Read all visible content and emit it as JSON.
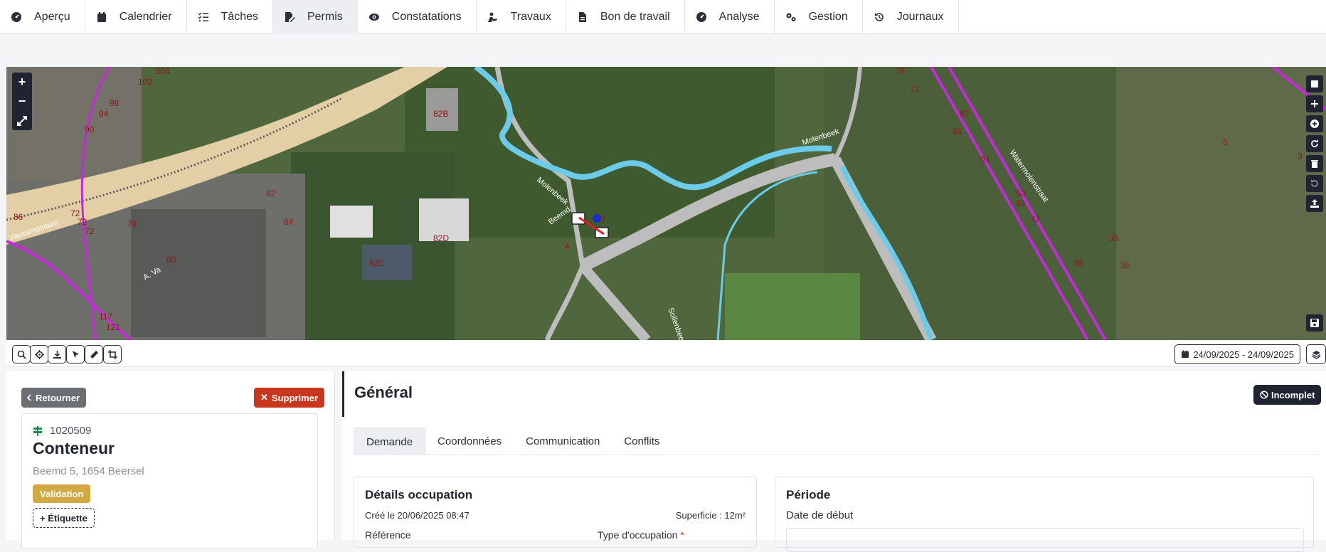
{
  "nav": {
    "items": [
      {
        "label": "Aperçu",
        "icon": "gauge-icon"
      },
      {
        "label": "Calendrier",
        "icon": "calendar-icon"
      },
      {
        "label": "Tâches",
        "icon": "list-check-icon"
      },
      {
        "label": "Permis",
        "icon": "file-pen-icon",
        "active": true
      },
      {
        "label": "Constatations",
        "icon": "eye-icon"
      },
      {
        "label": "Travaux",
        "icon": "worker-icon"
      },
      {
        "label": "Bon de travail",
        "icon": "document-icon"
      },
      {
        "label": "Analyse",
        "icon": "gauge-icon"
      },
      {
        "label": "Gestion",
        "icon": "gears-icon"
      },
      {
        "label": "Journaux",
        "icon": "history-icon"
      }
    ]
  },
  "map": {
    "zoom_in": "+",
    "zoom_out": "−",
    "street_labels": [
      "Vaucampslaan",
      "A. Va",
      "Beemd",
      "Sollenbeek",
      "Molenbeek",
      "Molenbeek",
      "Watermolenstraat"
    ],
    "house_numbers": [
      "104",
      "102",
      "98",
      "94",
      "90",
      "82B",
      "82D",
      "82E",
      "82",
      "84",
      "78",
      "80",
      "72",
      "72",
      "72",
      "86",
      "117",
      "121",
      "75",
      "71",
      "67",
      "65",
      "61",
      "53",
      "51",
      "47",
      "36",
      "39",
      "38",
      "5",
      "3",
      "9",
      "4"
    ]
  },
  "toolbar": {
    "date_range": "24/09/2025 - 24/09/2025"
  },
  "left": {
    "back_label": "Retourner",
    "delete_label": "Supprimer",
    "permit_id": "1020509",
    "title": "Conteneur",
    "address": "Beemd 5, 1654 Beersel",
    "status_badge": "Validation",
    "tag_button": "+ Étiquette"
  },
  "main": {
    "heading": "Général",
    "status": "Incomplet",
    "tabs": [
      "Demande",
      "Coordonnées",
      "Communication",
      "Conflits"
    ],
    "details": {
      "title": "Détails occupation",
      "created": "Créé le 20/06/2025 08:47",
      "superficie": "Superficie : 12m²",
      "field1": "Référence",
      "field2": "Type d'occupation"
    },
    "period": {
      "title": "Période",
      "start_label": "Date de début"
    }
  },
  "colors": {
    "primary_dark": "#1f2430",
    "danger": "#c7361d",
    "warning": "#d2a843",
    "neutral": "#6b6e73",
    "water": "#6ccbe8",
    "boundary": "#c42ad8"
  }
}
